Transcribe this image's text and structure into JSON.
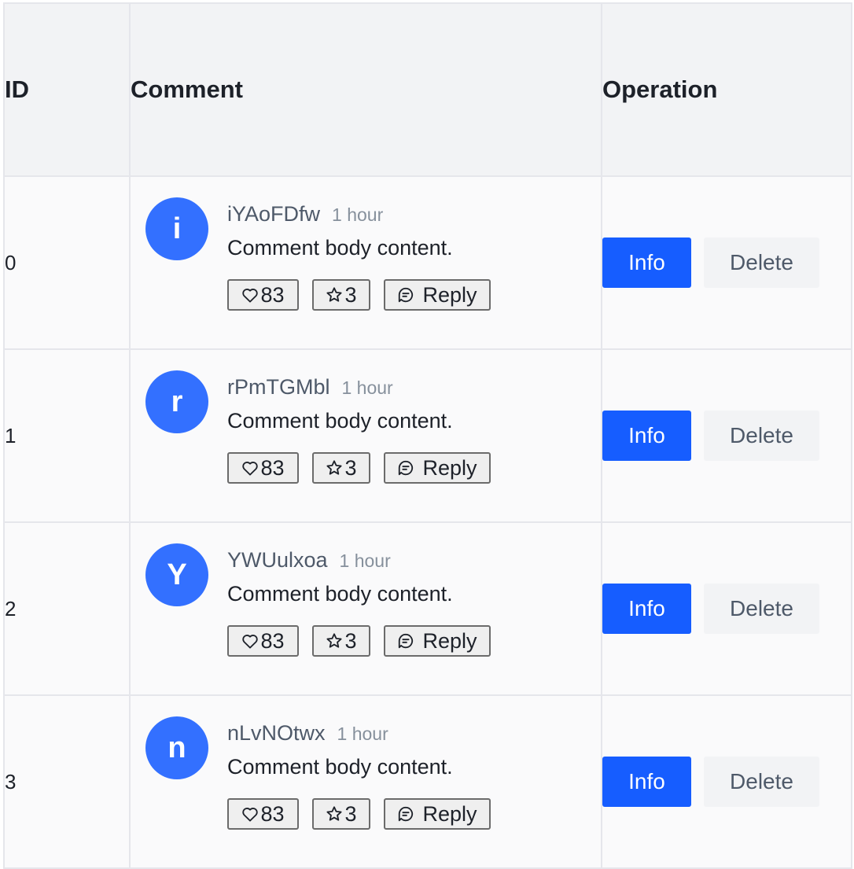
{
  "table": {
    "headers": {
      "id": "ID",
      "comment": "Comment",
      "operation": "Operation"
    },
    "rows": [
      {
        "id": "0",
        "avatar_letter": "i",
        "author": "iYAoFDfw",
        "time": "1 hour",
        "body": "Comment body content.",
        "likes": "83",
        "stars": "3",
        "reply_label": "Reply",
        "info_label": "Info",
        "delete_label": "Delete"
      },
      {
        "id": "1",
        "avatar_letter": "r",
        "author": "rPmTGMbl",
        "time": "1 hour",
        "body": "Comment body content.",
        "likes": "83",
        "stars": "3",
        "reply_label": "Reply",
        "info_label": "Info",
        "delete_label": "Delete"
      },
      {
        "id": "2",
        "avatar_letter": "Y",
        "author": "YWUulxoa",
        "time": "1 hour",
        "body": "Comment body content.",
        "likes": "83",
        "stars": "3",
        "reply_label": "Reply",
        "info_label": "Info",
        "delete_label": "Delete"
      },
      {
        "id": "3",
        "avatar_letter": "n",
        "author": "nLvNOtwx",
        "time": "1 hour",
        "body": "Comment body content.",
        "likes": "83",
        "stars": "3",
        "reply_label": "Reply",
        "info_label": "Info",
        "delete_label": "Delete"
      }
    ]
  },
  "icons": {
    "like": "heart-icon",
    "star": "star-icon",
    "reply": "message-icon"
  },
  "colors": {
    "avatar": "#3370ff",
    "primary": "#165dff",
    "header_bg": "#f2f3f5",
    "border": "#e5e6eb"
  }
}
